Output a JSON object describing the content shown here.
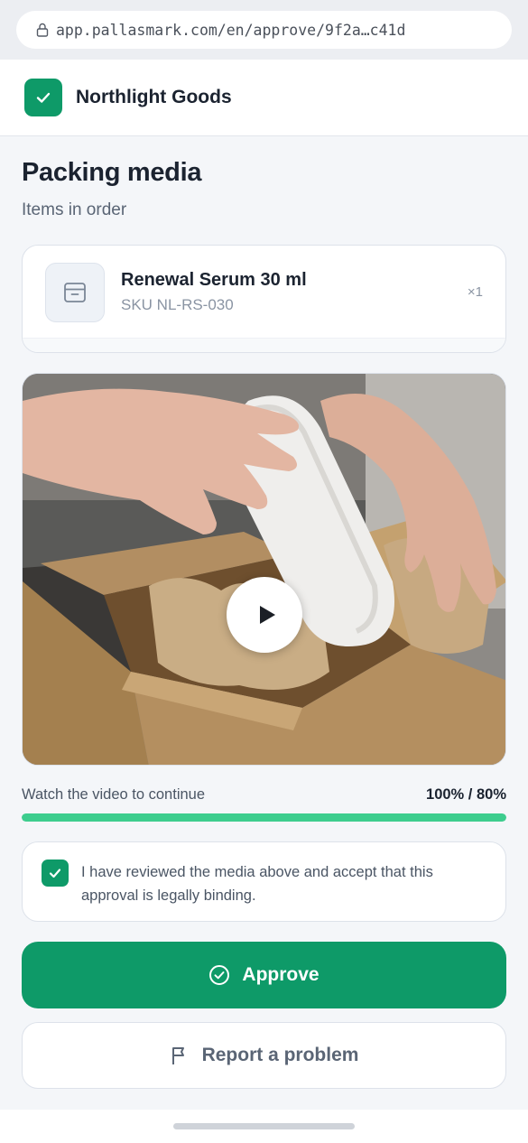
{
  "browser": {
    "url": "app.pallasmark.com/en/approve/9f2a…c41d",
    "icons": {
      "lock": "lock-icon"
    }
  },
  "header": {
    "brand_name": "Northlight Goods",
    "logo_icon": "check-icon"
  },
  "page": {
    "title": "Packing media",
    "subtitle": "Items in order"
  },
  "items": [
    {
      "name": "Renewal Serum 30 ml",
      "sku": "SKU NL-RS-030",
      "quantity": "×1",
      "icon": "archive-box-icon"
    }
  ],
  "video": {
    "play_icon": "play-icon",
    "description_icon": "video-thumbnail"
  },
  "progress": {
    "label": "Watch the video to continue",
    "value_text": "100% / 80%",
    "percent": 100
  },
  "consent": {
    "checked": true,
    "text": "I have reviewed the media above and accept that this approval is legally binding."
  },
  "actions": {
    "approve_label": "Approve",
    "approve_icon": "check-circle-icon",
    "report_label": "Report a problem",
    "report_icon": "flag-icon"
  },
  "colors": {
    "brand_green": "#0e9a68",
    "progress_green": "#3dcd8e",
    "background": "#f4f6f9"
  }
}
